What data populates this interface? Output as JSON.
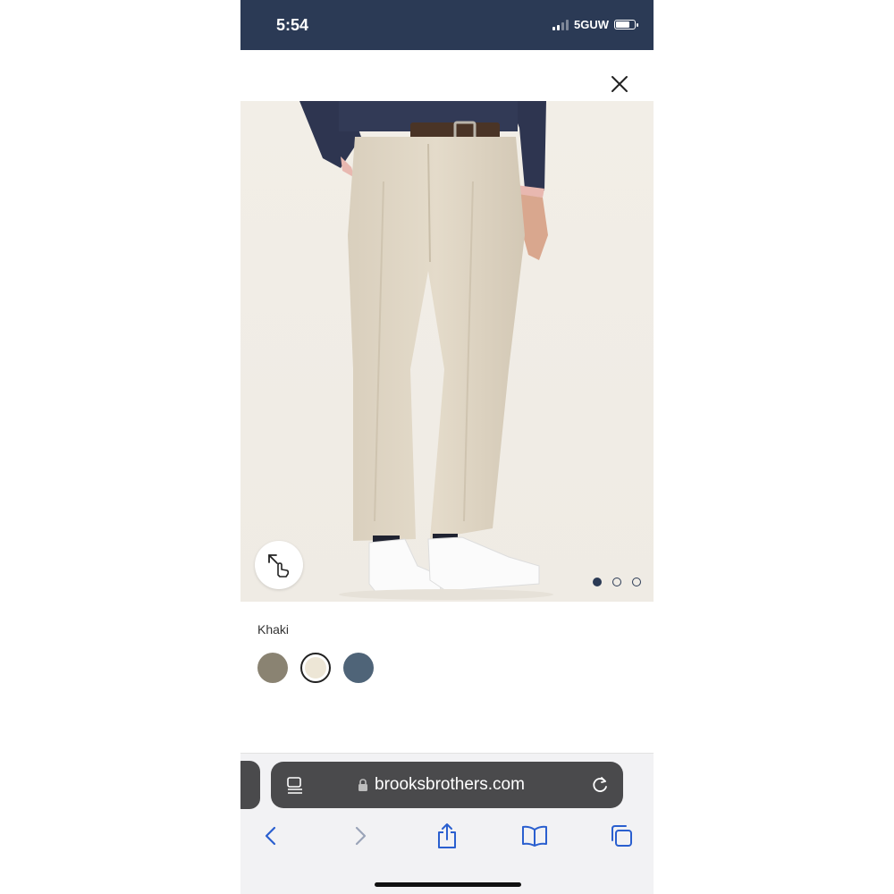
{
  "status_bar": {
    "time": "5:54",
    "network": "5GUW",
    "signal_bars_filled": 2,
    "battery_level": 0.8
  },
  "product": {
    "image_alt_icon": "trousers-photo",
    "carousel_pages": 3,
    "carousel_active": 1
  },
  "color_selection": {
    "selected_label": "Khaki",
    "swatches": [
      {
        "name": "olive-gray",
        "color": "#8a8372",
        "selected": false
      },
      {
        "name": "khaki",
        "color": "#ede6d6",
        "selected": true
      },
      {
        "name": "slate-blue",
        "color": "#4f6478",
        "selected": false
      }
    ]
  },
  "browser": {
    "url": "brooksbrothers.com",
    "secure": true
  },
  "colors": {
    "status_bar_bg": "#2b3a55",
    "accent": "#2b3a55",
    "url_bar_bg": "#4a4a4c"
  }
}
